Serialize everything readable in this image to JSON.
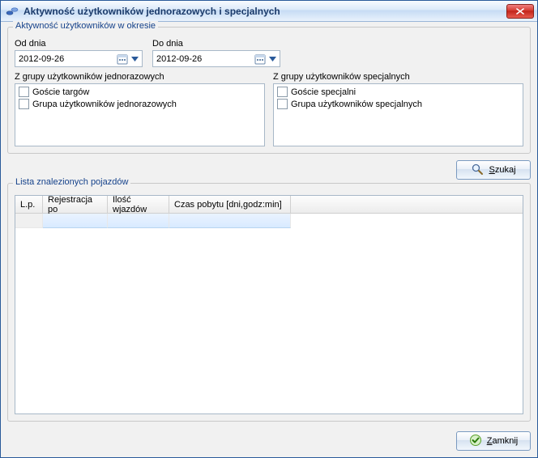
{
  "window": {
    "title": "Aktywność użytkowników jednorazowych i specjalnych"
  },
  "period": {
    "legend": "Aktywność użytkowników w okresie",
    "from_label": "Od dnia",
    "to_label": "Do dnia",
    "from_value": "2012-09-26",
    "to_value": "2012-09-26",
    "group_onetime_label": "Z grupy użytkowników jednorazowych",
    "group_special_label": "Z grupy użytkowników specjalnych",
    "onetime_items": {
      "0": "Goście targów",
      "1": "Grupa użytkowników jednorazowych"
    },
    "special_items": {
      "0": "Goście specjalni",
      "1": "Grupa użytkowników specjalnych"
    }
  },
  "buttons": {
    "search_u": "S",
    "search_rest": "zukaj",
    "close_u": "Z",
    "close_rest": "amknij"
  },
  "results": {
    "legend": "Lista znalezionych pojazdów",
    "columns": {
      "c0": "L.p.",
      "c1": "Rejestracja po",
      "c2": "Ilość wjazdów",
      "c3": "Czas pobytu [dni,godz:min]"
    }
  }
}
